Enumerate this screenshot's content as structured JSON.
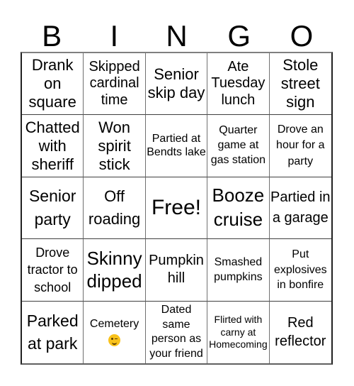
{
  "header": {
    "letters": [
      "B",
      "I",
      "N",
      "G",
      "O"
    ]
  },
  "cells": [
    [
      "Drank on square",
      "Skipped cardinal time",
      "Senior skip day",
      "Ate Tuesday lunch",
      "Stole street sign"
    ],
    [
      "Chatted with sheriff",
      "Won spirit stick",
      "Partied at Bendts lake",
      "Quarter game at gas station",
      "Drove an hour for a party"
    ],
    [
      "Senior party",
      "Off roading",
      "Free!",
      "Booze cruise",
      "Partied in a garage"
    ],
    [
      "Drove tractor to school",
      "Skinny dipped",
      "Pumpkin hill",
      "Smashed pumpkins",
      "Put explosives in bonfire"
    ],
    [
      "Parked at park",
      "Cemetery",
      "Dated same person as your friend",
      "Flirted with carny at Homecoming",
      "Red reflector"
    ]
  ],
  "cemetery_icon": "winking-face-emoji"
}
